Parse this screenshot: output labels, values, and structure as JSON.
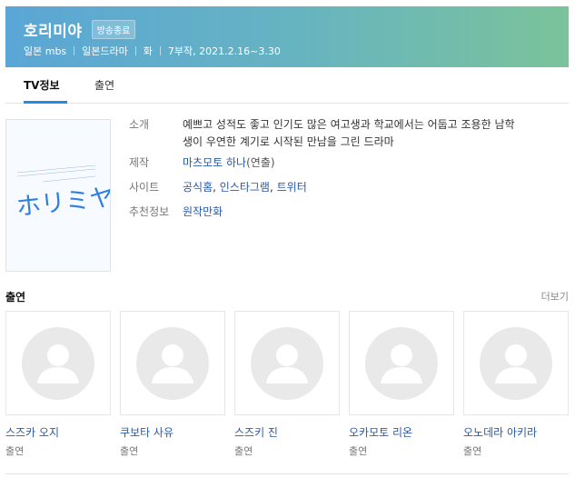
{
  "header": {
    "title": "호리미야",
    "badge": "방송종료",
    "meta": [
      "일본 mbs",
      "일본드라마",
      "화",
      "7부작, 2021.2.16~3.30"
    ]
  },
  "tabs": [
    {
      "label": "TV정보",
      "active": true
    },
    {
      "label": "출연",
      "active": false
    }
  ],
  "poster": {
    "logo_text": "ホリミヤ"
  },
  "info": {
    "intro_label": "소개",
    "intro_line1": "예쁘고 성적도 좋고 인기도 많은 여고생과 학교에서는 어둡고 조용한 남학",
    "intro_line2": "생이 우연한 계기로 시작된 만남을 그린 드라마",
    "production_label": "제작",
    "production_name": "마츠모토 하나",
    "production_role": "(연출)",
    "site_label": "사이트",
    "site_official": "공식홈",
    "site_instagram": "인스타그램",
    "site_twitter": "트위터",
    "site_sep": ", ",
    "rec_label": "추천정보",
    "rec_value": "원작만화"
  },
  "cast_section": {
    "title": "출연",
    "more": "더보기"
  },
  "cast": [
    {
      "name": "스즈카 오지",
      "role": "출연"
    },
    {
      "name": "쿠보타 사유",
      "role": "출연"
    },
    {
      "name": "스즈키 진",
      "role": "출연"
    },
    {
      "name": "오카모토 리온",
      "role": "출연"
    },
    {
      "name": "오노데라 아키라",
      "role": "출연"
    }
  ],
  "colors": {
    "accent": "#1f8ce6",
    "link": "#2a5aa8",
    "header_start": "#5aa6d6",
    "header_end": "#7bc39a"
  }
}
